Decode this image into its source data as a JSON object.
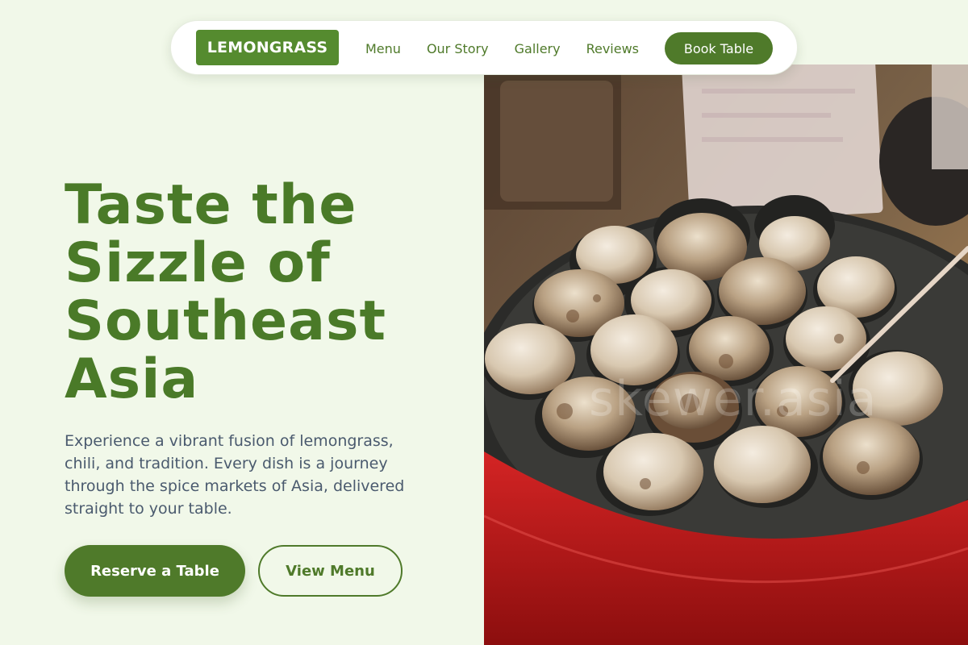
{
  "nav": {
    "brand": "LEMONGRASS",
    "links": [
      "Menu",
      "Our Story",
      "Gallery",
      "Reviews"
    ],
    "cta": "Book Table"
  },
  "hero": {
    "title_lines": [
      "Taste the",
      "Sizzle of",
      "Southeast",
      "Asia"
    ],
    "description": "Experience a vibrant fusion of lemongrass, chili, and tradition. Every dish is a journey through the spice markets of Asia, delivered straight to your table.",
    "primary_button": "Reserve a Table",
    "secondary_button": "View Menu"
  },
  "image": {
    "watermark": "skewer.asia",
    "pan_color": "#c41e1e",
    "plate_color": "#2a2a28"
  },
  "colors": {
    "accent": "#558b2f",
    "accent_dark": "#4f7a2a",
    "background": "#f1f8e9"
  }
}
